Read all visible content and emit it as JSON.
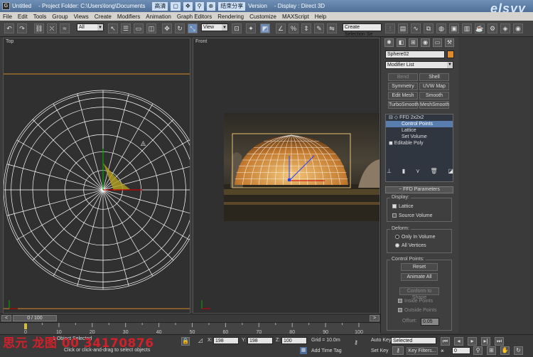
{
  "titlebar": {
    "app_icon": "3dsmax-icon",
    "title": "Untitled",
    "project_folder": "- Project Folder: C:\\Users\\long\\Documents",
    "mode_label": "高清",
    "glyph_label": "结束分享",
    "version_label": "Version",
    "display_label": "- Display : Direct 3D",
    "logo": "elsyy"
  },
  "menubar": {
    "items": [
      "File",
      "Edit",
      "Tools",
      "Group",
      "Views",
      "Create",
      "Modifiers",
      "Animation",
      "Graph Editors",
      "Rendering",
      "Customize",
      "MAXScript",
      "Help"
    ]
  },
  "toolbar": {
    "selection_filter": "All",
    "reference_coord": "View",
    "named_selection": "Create Selection Se"
  },
  "viewports": {
    "top_label": "Top",
    "front_label": "Front"
  },
  "command_panel": {
    "object_name": "Sphere02",
    "object_color": "#e08a2e",
    "modifier_list": "Modifier List",
    "modifier_buttons": [
      {
        "label": "Bend",
        "disabled": true
      },
      {
        "label": "Shell",
        "disabled": false
      },
      {
        "label": "Symmetry",
        "disabled": false
      },
      {
        "label": "UVW Map",
        "disabled": false
      },
      {
        "label": "Edit Mesh",
        "disabled": false
      },
      {
        "label": "Smooth",
        "disabled": false
      },
      {
        "label": "TurboSmooth",
        "disabled": false
      },
      {
        "label": "MeshSmooth",
        "disabled": false
      }
    ],
    "stack": [
      {
        "label": "FFD 2x2x2",
        "indent": 0,
        "selected": false
      },
      {
        "label": "Control Points",
        "indent": 1,
        "selected": true
      },
      {
        "label": "Lattice",
        "indent": 1,
        "selected": false
      },
      {
        "label": "Set Volume",
        "indent": 1,
        "selected": false
      },
      {
        "label": "Editable Poly",
        "indent": 0,
        "selected": false
      }
    ],
    "rollout_title": "FFD Parameters",
    "display_group": "Display:",
    "lattice_label": "Lattice",
    "source_volume_label": "Source Volume",
    "deform_group": "Deform:",
    "only_in_volume_label": "Only In Volume",
    "all_vertices_label": "All Vertices",
    "control_points_group": "Control Points:",
    "reset_label": "Reset",
    "animate_all_label": "Animate All",
    "conform_label": "Conform to Shape",
    "inside_points_label": "Inside Points",
    "outside_points_label": "Outside Points",
    "offset_label": "Offset:",
    "offset_value": "0.05"
  },
  "timeline": {
    "frame_display": "0 / 100",
    "ticks": [
      "0",
      "10",
      "20",
      "30",
      "40",
      "50",
      "60",
      "70",
      "80",
      "90",
      "100"
    ]
  },
  "statusbar": {
    "selection_info": "1 Object Selected",
    "prompt": "Click or click-and-drag to select objects",
    "x_label": "X:",
    "x_value": "198",
    "y_label": "Y:",
    "y_value": "198",
    "z_label": "Z:",
    "z_value": "100",
    "grid_label": "Grid = 10.0m",
    "add_time_tag": "Add Time Tag",
    "auto_key": "Auto Key",
    "set_key": "Set Key",
    "key_mode": "Selected",
    "key_filters": "Key Filters...",
    "current_frame": "0"
  },
  "overlay": {
    "watermark": "思元 龙图 00 34170876"
  },
  "colors": {
    "wireframe": "#ffffff",
    "viewport_bg": "#303030",
    "orange_line": "#d98a2a",
    "accent_selection": "#5a7db0"
  }
}
